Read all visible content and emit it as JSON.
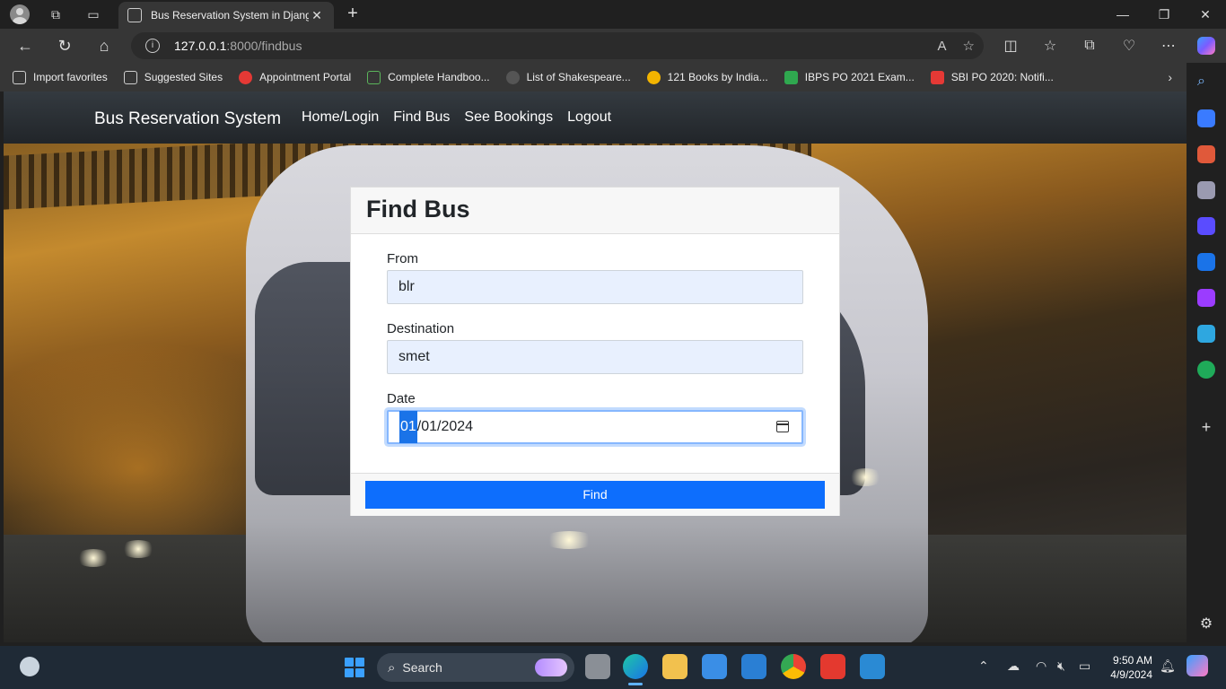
{
  "browser": {
    "tab_title": "Bus Reservation System in Djang",
    "tab_close": "✕",
    "new_tab": "+",
    "url_host": "127.0.0.1",
    "url_path": ":8000/findbus",
    "minimize": "—",
    "maximize": "❐",
    "close": "✕"
  },
  "favorites": [
    {
      "label": "Import favorites",
      "color": "#cfcfcf"
    },
    {
      "label": "Suggested Sites",
      "color": "#cfcfcf"
    },
    {
      "label": "Appointment Portal",
      "color": "#e53935"
    },
    {
      "label": "Complete Handboo...",
      "color": "#5bb55b"
    },
    {
      "label": "List of Shakespeare...",
      "color": "#555555"
    },
    {
      "label": "121 Books by India...",
      "color": "#f3b400"
    },
    {
      "label": "IBPS PO 2021 Exam...",
      "color": "#2fa84f"
    },
    {
      "label": "SBI PO 2020: Notifi...",
      "color": "#e53935"
    }
  ],
  "site": {
    "brand": "Bus Reservation System",
    "nav": [
      "Home/Login",
      "Find Bus",
      "See Bookings",
      "Logout"
    ]
  },
  "form": {
    "title": "Find Bus",
    "from_label": "From",
    "from_value": "blr",
    "destination_label": "Destination",
    "destination_value": "smet",
    "date_label": "Date",
    "date_selected": "01",
    "date_rest": "/01/2024",
    "find_button": "Find"
  },
  "taskbar": {
    "search_label": "Search",
    "time": "9:50 AM",
    "date": "4/9/2024"
  },
  "colors": {
    "accent": "#0d6efd",
    "navbar": "#212529",
    "input_fill": "#e8f0fe"
  }
}
